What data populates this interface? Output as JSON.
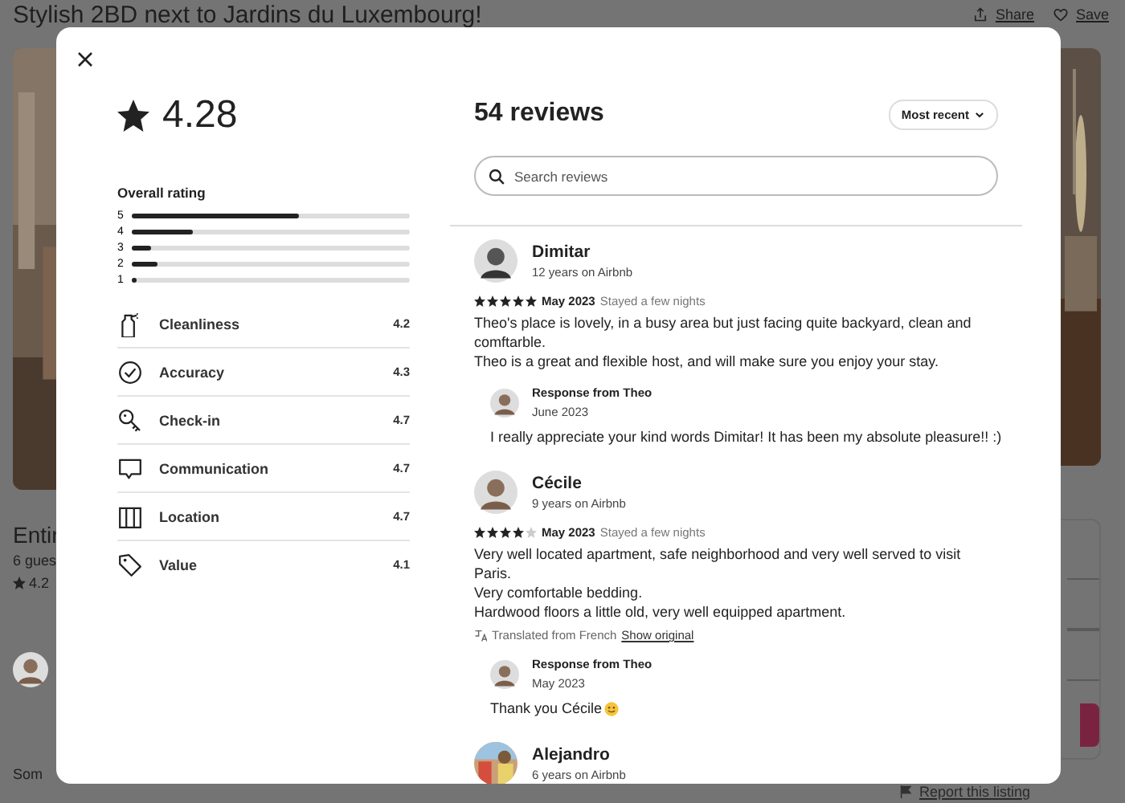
{
  "page": {
    "title": "Stylish 2BD next to Jardins du Luxembourg!",
    "actions": [
      {
        "label": "Share"
      },
      {
        "label": "Save"
      }
    ],
    "listing": {
      "heading": "Entir",
      "guests": "6 gues",
      "rating": "4.2"
    },
    "section_text": "Som",
    "report_link": "Report this listing"
  },
  "modal": {
    "rating": "4.28",
    "overall_label": "Overall rating",
    "distribution": [
      {
        "label": "5",
        "level": 0.6
      },
      {
        "label": "4",
        "level": 0.22
      },
      {
        "label": "3",
        "level": 0.07
      },
      {
        "label": "2",
        "level": 0.09
      },
      {
        "label": "1",
        "level": 0.01
      }
    ],
    "categories": [
      {
        "name": "Cleanliness",
        "score": "4.2"
      },
      {
        "name": "Accuracy",
        "score": "4.3"
      },
      {
        "name": "Check-in",
        "score": "4.7"
      },
      {
        "name": "Communication",
        "score": "4.7"
      },
      {
        "name": "Location",
        "score": "4.7"
      },
      {
        "name": "Value",
        "score": "4.1"
      }
    ],
    "title": "54 reviews",
    "sort": "Most recent",
    "search": {
      "placeholder": "Search reviews"
    },
    "reviews": [
      {
        "name": "Dimitar",
        "tenure": "12 years on Airbnb",
        "stars": 5,
        "date": "May 2023",
        "stay": "Stayed a few nights",
        "text": "Theo's place is lovely, in a busy area but just facing quite backyard, clean and comftarble.\nTheo is a great and flexible host, and will make sure you enjoy your stay.",
        "response": {
          "title": "Response from Theo",
          "date": "June 2023",
          "text": "I really appreciate your kind words Dimitar! It has been my absolute pleasure!! :)"
        }
      },
      {
        "name": "Cécile",
        "tenure": "9 years on Airbnb",
        "stars": 4,
        "date": "May 2023",
        "stay": "Stayed a few nights",
        "text": "Very well located apartment, safe neighborhood and very well served to visit Paris.\nVery comfortable bedding.\nHardwood floors a little old, very well equipped apartment.",
        "translation": {
          "note": "Translated from French",
          "link": "Show original"
        },
        "response": {
          "title": "Response from Theo",
          "date": "May 2023",
          "text": "Thank you Cécile",
          "emoji": true
        }
      },
      {
        "name": "Alejandro",
        "tenure": "6 years on Airbnb"
      }
    ]
  }
}
